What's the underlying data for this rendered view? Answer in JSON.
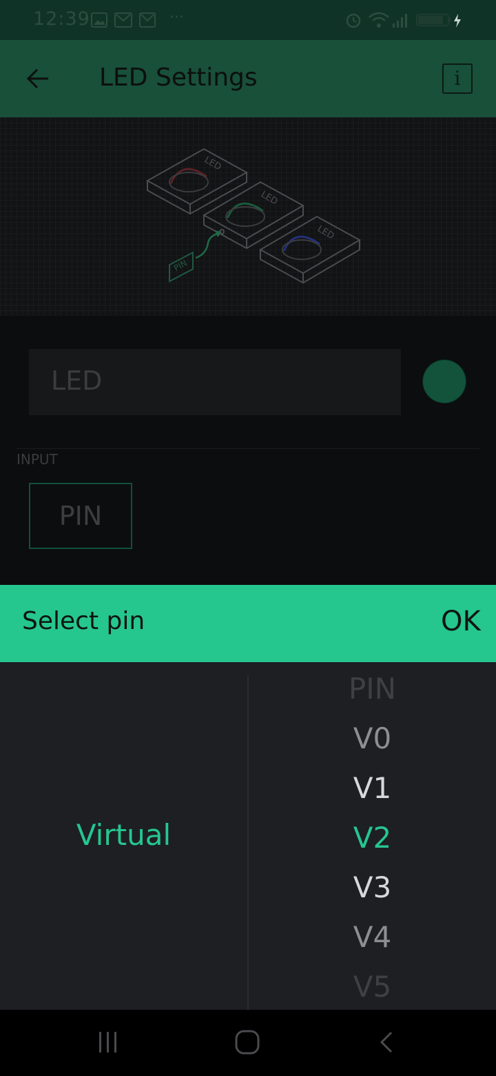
{
  "status_bar": {
    "time": "12:39",
    "icons": [
      "image-icon",
      "mail-icon",
      "mail-icon",
      "more-icon",
      "alarm-icon",
      "wifi-icon",
      "signal-icon",
      "battery-icon",
      "charging-icon"
    ]
  },
  "app_bar": {
    "title": "LED Settings",
    "info_label": "i"
  },
  "preview": {
    "led_label_1": "LED",
    "led_label_2": "LED",
    "led_label_3": "LED",
    "pin_tag": "PIN"
  },
  "settings": {
    "name_value": "LED",
    "color": "#13533b",
    "input_section_label": "INPUT",
    "pin_button_label": "PIN"
  },
  "pin_sheet": {
    "title": "Select pin",
    "ok_label": "OK",
    "type_selected": "Virtual",
    "pin_options": [
      "PIN",
      "V0",
      "V1",
      "V2",
      "V3",
      "V4",
      "V5"
    ],
    "selected_pin": "V2",
    "accent_color": "#26c68f"
  },
  "nav_bar": {
    "icons": [
      "recents-icon",
      "home-icon",
      "back-icon"
    ]
  }
}
